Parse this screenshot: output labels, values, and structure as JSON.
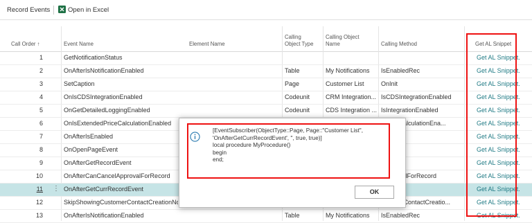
{
  "toolbar": {
    "record_events": "Record Events",
    "open_in_excel": "Open in Excel"
  },
  "headers": {
    "call_order": "Call Order ↑",
    "event_name": "Event Name",
    "element_name": "Element Name",
    "calling_object_type": [
      "Calling",
      "Object Type"
    ],
    "calling_object_name": [
      "Calling Object",
      "Name"
    ],
    "calling_method": "Calling Method",
    "get_al_snippet": "Get AL Snippet"
  },
  "rows": [
    {
      "order": "1",
      "event": "GetNotificationStatus",
      "type": "",
      "object": "",
      "method": "",
      "snippet": "Get AL Snippet."
    },
    {
      "order": "2",
      "event": "OnAfterIsNotificationEnabled",
      "type": "Table",
      "object": "My Notifications",
      "method": "IsEnabledRec",
      "snippet": "Get AL Snippet."
    },
    {
      "order": "3",
      "event": "SetCaption",
      "type": "Page",
      "object": "Customer List",
      "method": "OnInit",
      "snippet": "Get AL Snippet."
    },
    {
      "order": "4",
      "event": "OnIsCDSIntegrationEnabled",
      "type": "Codeunit",
      "object": "CRM Integration...",
      "method": "IsCDSIntegrationEnabled",
      "snippet": "Get AL Snippet."
    },
    {
      "order": "5",
      "event": "OnGetDetailedLoggingEnabled",
      "type": "Codeunit",
      "object": "CDS Integration ...",
      "method": "IsIntegrationEnabled",
      "snippet": "Get AL Snippet."
    },
    {
      "order": "6",
      "event": "OnIsExtendedPriceCalculationEnabled",
      "type": "",
      "object": "",
      "method": "dPriceCalculationEna...",
      "snippet": "Get AL Snippet."
    },
    {
      "order": "7",
      "event": "OnAfterIsEnabled",
      "type": "",
      "object": "",
      "method": "",
      "snippet": "Get AL Snippet."
    },
    {
      "order": "8",
      "event": "OnOpenPageEvent",
      "type": "",
      "object": "",
      "method": "",
      "snippet": "Get AL Snippet."
    },
    {
      "order": "9",
      "event": "OnAfterGetRecordEvent",
      "type": "",
      "object": "",
      "method": "",
      "snippet": "Get AL Snippet."
    },
    {
      "order": "10",
      "event": "OnAfterCanCancelApprovalForRecord",
      "type": "",
      "object": "",
      "method": "lApprovalForRecord",
      "snippet": "Get AL Snippet."
    },
    {
      "order": "11",
      "event": "OnAfterGetCurrRecordEvent",
      "type": "",
      "object": "",
      "method": "",
      "snippet": "Get AL Snippet."
    },
    {
      "order": "12",
      "event": "SkipShowingCustomerContactCreationNo",
      "type": "",
      "object": "",
      "method": "ustomerContactCreatio...",
      "snippet": "Get AL Snippet."
    },
    {
      "order": "13",
      "event": "OnAfterIsNotificationEnabled",
      "type": "Table",
      "object": "My Notifications",
      "method": "IsEnabledRec",
      "snippet": "Get AL Snippet."
    }
  ],
  "dialog": {
    "lines": [
      "[EventSubscriber(ObjectType::Page, Page::\"Customer List\",",
      "'OnAfterGetCurrRecordEvent', '', true, true)]",
      "local procedure MyProcedure()",
      "begin",
      "end;"
    ],
    "ok_label": "OK",
    "icon": "info-icon"
  },
  "colors": {
    "link": "#1f7a84",
    "selected_row": "#c6e4e6",
    "highlight": "#ee1111",
    "excel": "#1e7145"
  }
}
